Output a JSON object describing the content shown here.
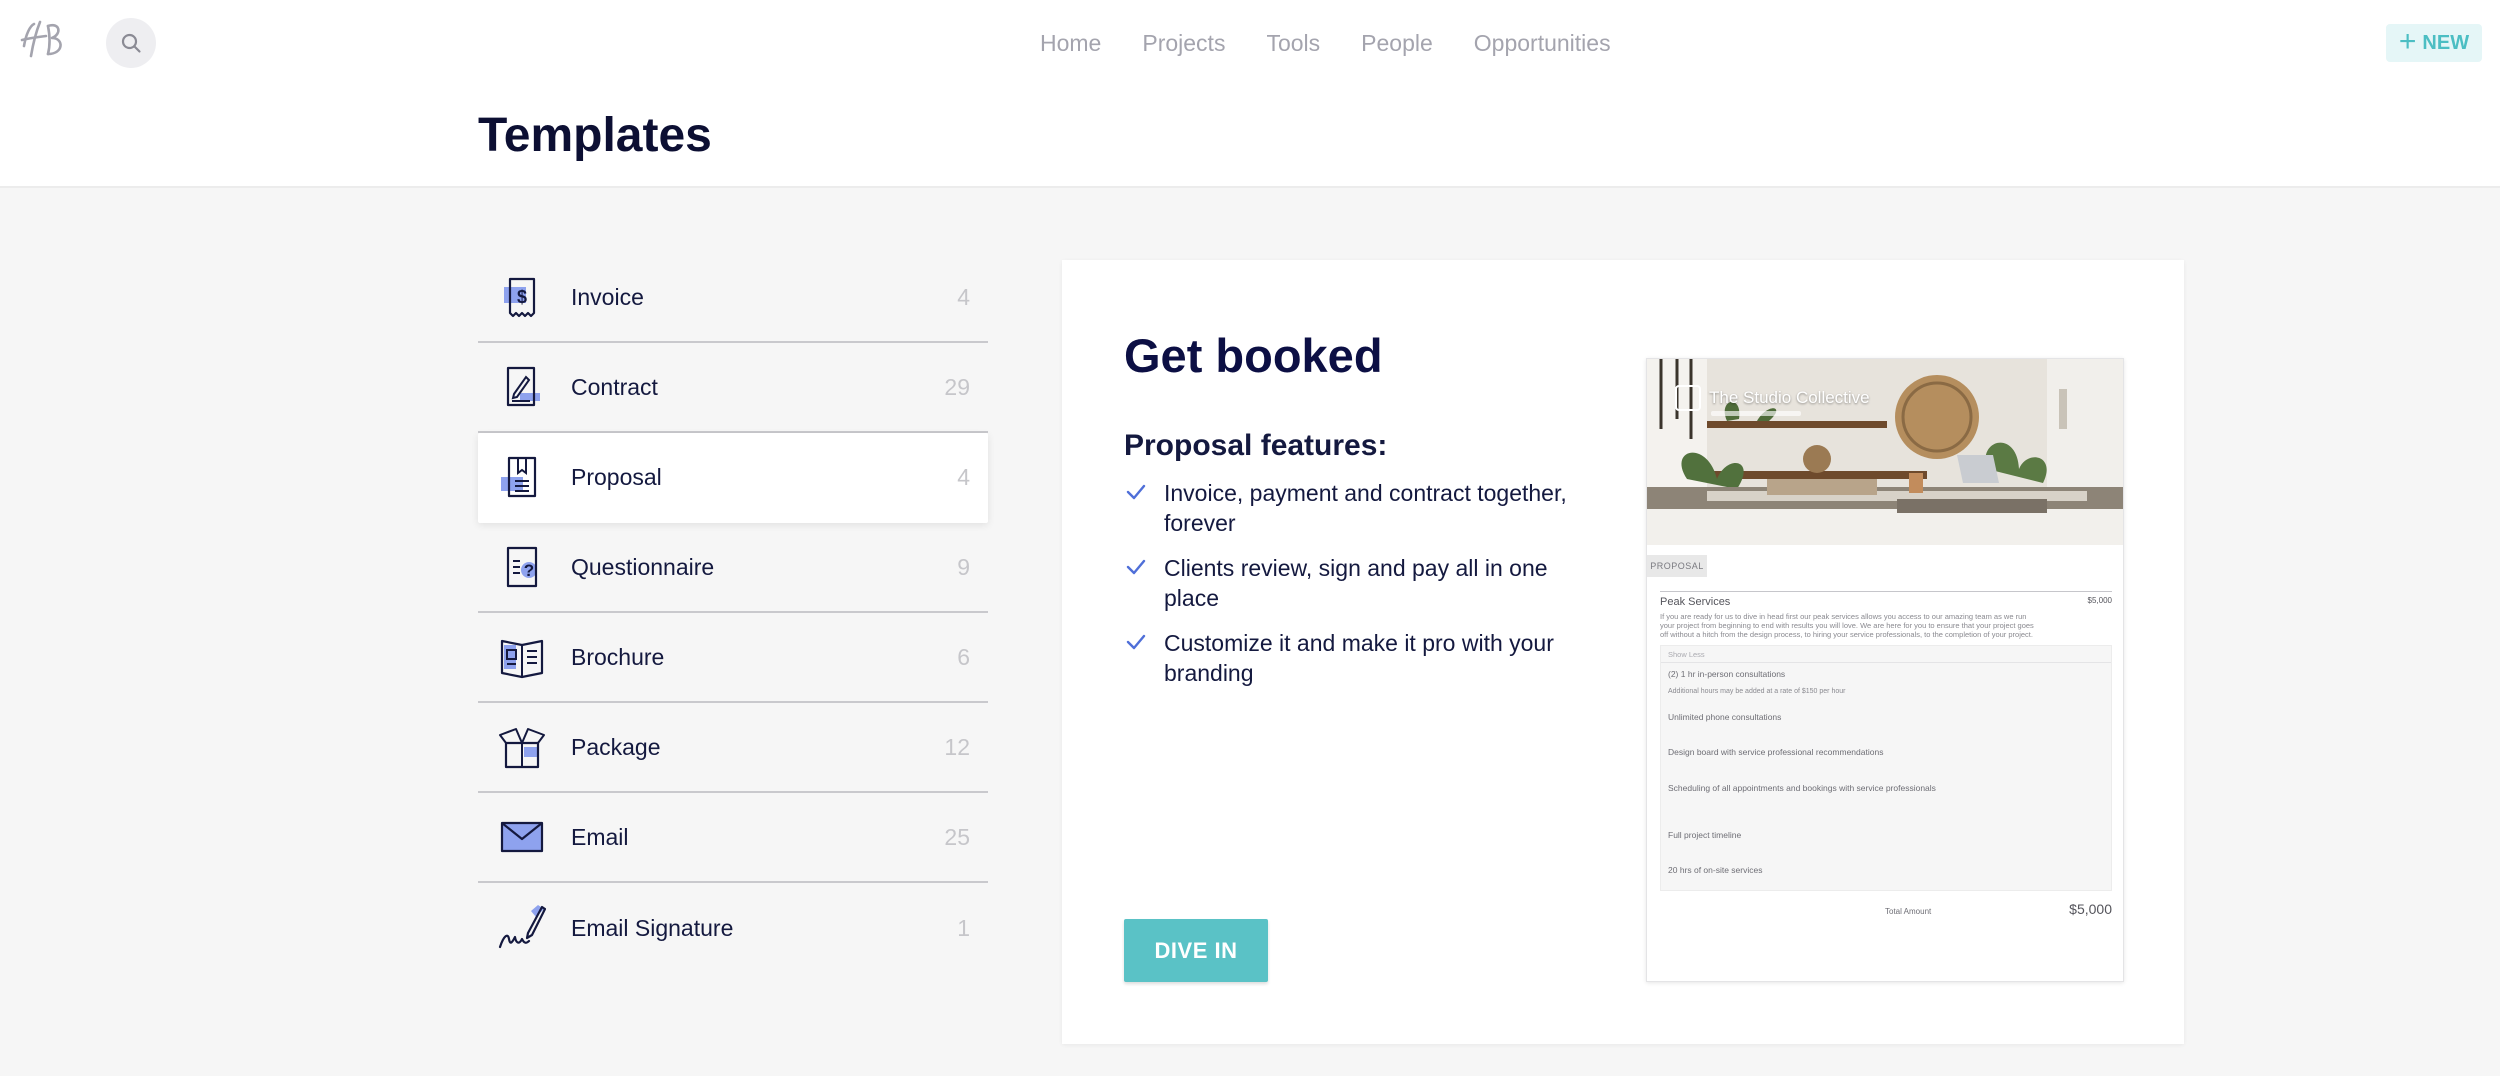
{
  "header": {
    "nav": [
      "Home",
      "Projects",
      "Tools",
      "People",
      "Opportunities"
    ],
    "new_label": "NEW"
  },
  "page_title": "Templates",
  "templates": [
    {
      "label": "Invoice",
      "count": "4",
      "icon": "invoice-icon"
    },
    {
      "label": "Contract",
      "count": "29",
      "icon": "contract-icon"
    },
    {
      "label": "Proposal",
      "count": "4",
      "icon": "proposal-icon",
      "selected": true
    },
    {
      "label": "Questionnaire",
      "count": "9",
      "icon": "questionnaire-icon"
    },
    {
      "label": "Brochure",
      "count": "6",
      "icon": "brochure-icon"
    },
    {
      "label": "Package",
      "count": "12",
      "icon": "package-icon"
    },
    {
      "label": "Email",
      "count": "25",
      "icon": "email-icon"
    },
    {
      "label": "Email Signature",
      "count": "1",
      "icon": "email-signature-icon"
    }
  ],
  "detail": {
    "heading": "Get booked",
    "features_title": "Proposal features:",
    "features": [
      "Invoice, payment and contract together, forever",
      "Clients review, sign and pay all in one place",
      "Customize it and make it pro with your branding"
    ],
    "cta": "DIVE IN",
    "preview": {
      "brand": "The Studio Collective",
      "tab": "PROPOSAL",
      "service_title": "Peak Services",
      "service_price": "$5,000",
      "description": "If you are ready for us to dive in head first our peak services allows you access to our amazing team as we run your project from beginning to end with results you will love. We are here for you to ensure that your project goes off without a hitch from the design process, to hiring your service professionals, to the completion of your project.",
      "show_less": "Show Less",
      "items": [
        "(2) 1 hr in-person consultations",
        "Additional hours may be added at a rate of $150 per hour",
        "Unlimited phone consultations",
        "Design board with service professional recommendations",
        "Scheduling of all appointments and bookings with service professionals",
        "Full project timeline",
        "20 hrs of on-site services"
      ],
      "total_label": "Total Amount",
      "total_value": "$5,000"
    }
  },
  "colors": {
    "accent": "#5ac2c6",
    "navy": "#0c0f44",
    "icon_fill": "#8ea2ee",
    "check": "#4f6fd8",
    "muted": "#a4a4ae"
  }
}
